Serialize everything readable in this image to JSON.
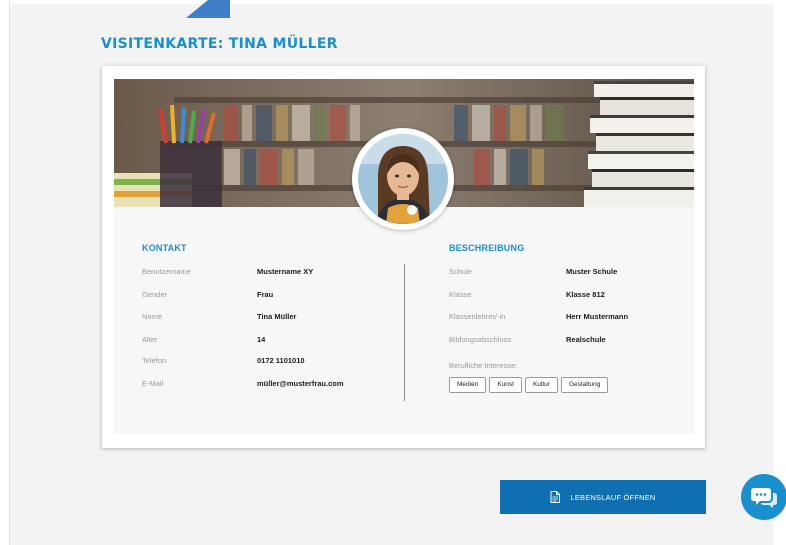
{
  "colors": {
    "accent": "#1a8fd0",
    "button": "#0f6fb0",
    "page_background": "#f3f3f3",
    "label_text": "#9a9a9a"
  },
  "header": {
    "title": "VISITENKARTE: TINA MÜLLER"
  },
  "profile": {
    "avatar_icon": "student-portrait",
    "banner_image": "bookshelf-with-pencils-and-books"
  },
  "contact": {
    "heading": "KONTAKT",
    "rows": [
      {
        "label": "Benutzername",
        "value": "Mustername XY"
      },
      {
        "label": "Gender",
        "value": "Frau"
      },
      {
        "label": "Name",
        "value": "Tina Müller"
      },
      {
        "label": "Alter",
        "value": "14"
      },
      {
        "label": "Telefon",
        "value": "0172 1101010"
      },
      {
        "label": "E-Mail",
        "value": "müller@musterfrau.com"
      }
    ]
  },
  "description": {
    "heading": "BESCHREIBUNG",
    "rows": [
      {
        "label": "Schule",
        "value": "Muster Schule"
      },
      {
        "label": "Klasse",
        "value": "Klasse 812"
      },
      {
        "label": "Klassenlehrer/-in",
        "value": "Herr Mustermann"
      },
      {
        "label": "Bildungsabschluss",
        "value": "Realschule"
      }
    ],
    "interests_label": "Berufliche Interesse:",
    "interests": [
      "Medien",
      "Kunst",
      "Kultur",
      "Gestaltung"
    ]
  },
  "actions": {
    "cv_button_label": "LEBENSLAUF ÖFFNEN",
    "cv_button_icon": "document-icon",
    "chat_icon": "chat-icon"
  }
}
